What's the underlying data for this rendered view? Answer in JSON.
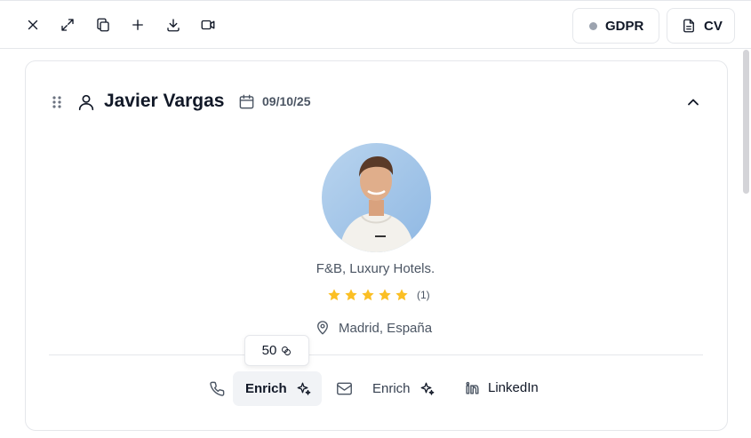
{
  "toolbar": {
    "icons": [
      "close-icon",
      "expand-icon",
      "copy-icon",
      "plus-icon",
      "download-icon",
      "video-icon"
    ],
    "gdpr_label": "GDPR",
    "gdpr_status_color": "#9ca3af",
    "cv_label": "CV"
  },
  "profile": {
    "name": "Javier Vargas",
    "date": "09/10/25",
    "tagline": "F&B, Luxury Hotels.",
    "rating": {
      "stars": 5,
      "count_label": "(1)"
    },
    "location": "Madrid, España"
  },
  "contact": {
    "tooltip_value": "50",
    "phone_enrich_label": "Enrich",
    "email_enrich_label": "Enrich",
    "linkedin_label": "LinkedIn"
  },
  "colors": {
    "star": "#fbbf24",
    "active_button_bg": "#f1f3f6"
  }
}
